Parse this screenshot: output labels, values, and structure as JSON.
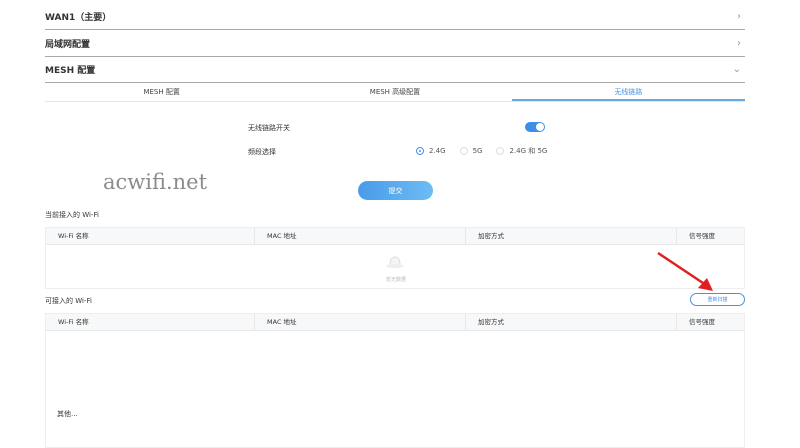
{
  "sections": [
    {
      "label": "WAN1（主要）",
      "state": "collapsed"
    },
    {
      "label": "局域网配置",
      "state": "collapsed"
    },
    {
      "label": "MESH 配置",
      "state": "expanded"
    }
  ],
  "tabs": [
    {
      "label": "MESH 配置"
    },
    {
      "label": "MESH 高级配置"
    },
    {
      "label": "无线链路",
      "active": true
    }
  ],
  "form": {
    "switch_label": "无线链路开关",
    "switch_on": true,
    "band_label": "频段选择",
    "band_options": [
      "2.4G",
      "5G",
      "2.4G 和 5G"
    ],
    "band_selected": "2.4G",
    "submit": "提交"
  },
  "watermark": "acwifi.net",
  "connected": {
    "title": "当前接入的 Wi-Fi",
    "columns": [
      "Wi-Fi 名称",
      "MAC 地址",
      "加密方式",
      "信号强度"
    ],
    "empty_text": "暂无数据"
  },
  "available": {
    "title": "可接入的 Wi-Fi",
    "rescan": "重新扫描",
    "columns": [
      "Wi-Fi 名称",
      "MAC 地址",
      "加密方式",
      "信号强度"
    ],
    "other": "其他..."
  },
  "colors": {
    "accent": "#4a90e2",
    "arrow": "#e02020"
  }
}
